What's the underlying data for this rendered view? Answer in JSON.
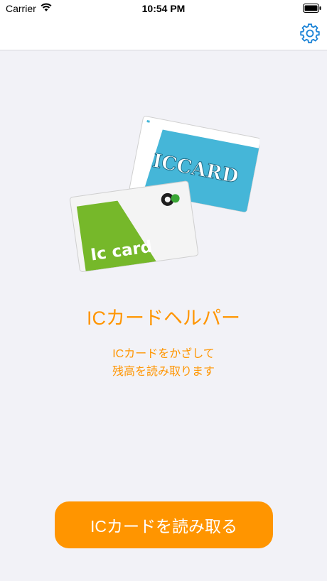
{
  "status_bar": {
    "carrier": "Carrier",
    "time": "10:54 PM"
  },
  "nav": {
    "settings_icon": "gear-icon",
    "accent_color": "#1a82d6"
  },
  "illustration": {
    "blue_card_text": "ICCARD",
    "green_card_text": "Ic card",
    "blue_card_color": "#45b6d8",
    "green_card_color": "#76b82a"
  },
  "main": {
    "title": "ICカードヘルパー",
    "subtitle_line1": "ICカードをかざして",
    "subtitle_line2": "残高を読み取ります",
    "accent_color": "#ff9500"
  },
  "button": {
    "label": "ICカードを読み取る"
  }
}
